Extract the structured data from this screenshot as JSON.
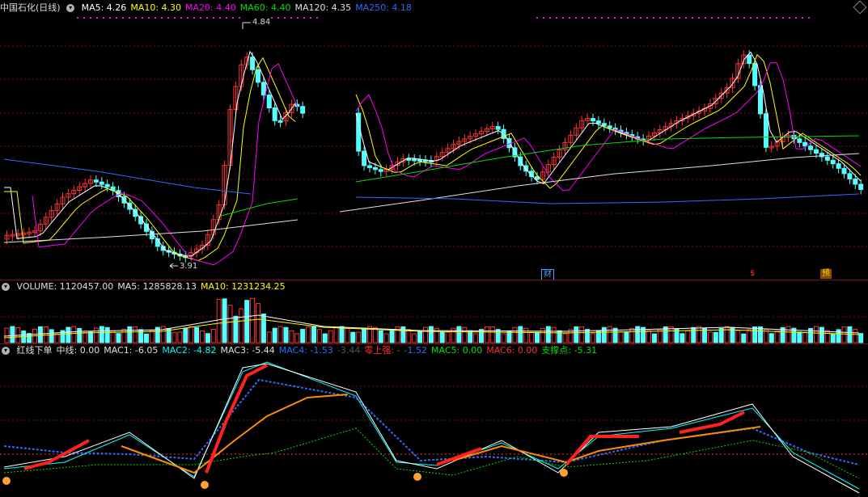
{
  "main_panel": {
    "title": "中国石化(日线)",
    "indicators": [
      {
        "label": "MA5: 4.26",
        "color": "#ffffff"
      },
      {
        "label": "MA10: 4.30",
        "color": "#ffff00"
      },
      {
        "label": "MA20: 4.40",
        "color": "#ff00ff"
      },
      {
        "label": "MA60: 4.40",
        "color": "#00e000"
      },
      {
        "label": "MA120: 4.35",
        "color": "#e0e0e0"
      },
      {
        "label": "MA250: 4.18",
        "color": "#2d6bff"
      }
    ],
    "high_label": "4.84",
    "low_label": "3.91",
    "event_markers": [
      {
        "label": "财",
        "color": "#4aa0ff"
      },
      {
        "label": "$",
        "color": "#ff3030"
      },
      {
        "label": "预",
        "color": "#ff8c00"
      }
    ]
  },
  "volume_panel": {
    "indicators": [
      {
        "label": "VOLUME: 1120457.00",
        "color": "#e0e0e0"
      },
      {
        "label": "MA5: 1285828.13",
        "color": "#e0e0e0"
      },
      {
        "label": "MA10: 1231234.25",
        "color": "#ffff00"
      }
    ]
  },
  "macd_panel": {
    "indicators": [
      {
        "label": "红线下单",
        "color": "#e0e0e0"
      },
      {
        "label": "中线: 0.00",
        "color": "#e0e0e0"
      },
      {
        "label": "MAC1: -6.05",
        "color": "#e0e0e0"
      },
      {
        "label": "MAC2: -4.82",
        "color": "#00ffff"
      },
      {
        "label": "MAC3: -5.44",
        "color": "#e0e0e0"
      },
      {
        "label": "MAC4: -1.53",
        "color": "#2d6bff"
      },
      {
        "label": "-3.44",
        "color": "#555555"
      },
      {
        "label": "零上强: -",
        "color": "#ff3030"
      },
      {
        "label": "-1.52",
        "color": "#2d6bff"
      },
      {
        "label": "MAC5: 0.00",
        "color": "#00e000"
      },
      {
        "label": "MAC6: 0.00",
        "color": "#ff3030"
      },
      {
        "label": "支撑点: -5.31",
        "color": "#00e000"
      }
    ]
  },
  "colors": {
    "up": "#ff3333",
    "down": "#54ffff",
    "grid": "#7a1010"
  }
}
